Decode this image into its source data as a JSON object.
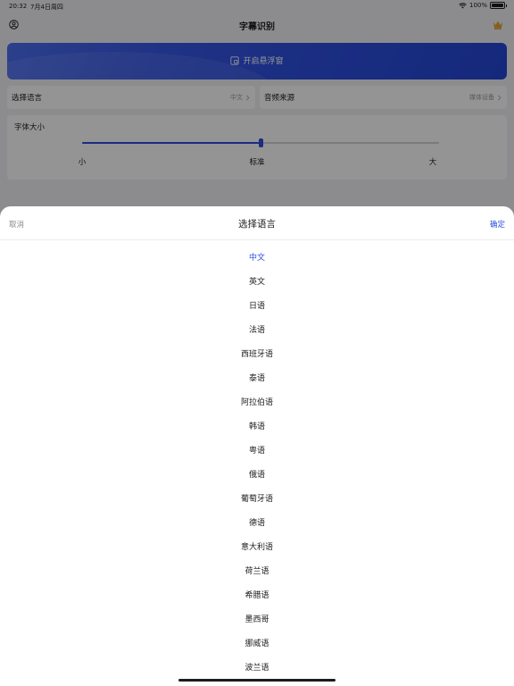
{
  "status": {
    "time": "20:32",
    "date": "7月4日周四",
    "battery": "100%"
  },
  "nav": {
    "title": "字幕识别"
  },
  "float_button": {
    "label": "开启悬浮窗"
  },
  "settings": {
    "language": {
      "label": "选择语言",
      "value": "中文"
    },
    "audio": {
      "label": "音频来源",
      "value": "媒体设备"
    },
    "font": {
      "title": "字体大小",
      "ticks": [
        "小",
        "标准",
        "大"
      ],
      "level": 0.5
    }
  },
  "sheet": {
    "cancel": "取消",
    "title": "选择语言",
    "confirm": "确定",
    "selected_index": 0,
    "languages": [
      "中文",
      "英文",
      "日语",
      "法语",
      "西班牙语",
      "泰语",
      "阿拉伯语",
      "韩语",
      "粤语",
      "俄语",
      "葡萄牙语",
      "德语",
      "意大利语",
      "荷兰语",
      "希腊语",
      "墨西哥",
      "挪威语",
      "波兰语"
    ]
  },
  "colors": {
    "accent": "#2d4fe0",
    "muted": "#8a8a8f"
  },
  "icons": {
    "nav_left": "user-circle-icon",
    "nav_right": "crown-icon",
    "float": "floating-window-icon"
  }
}
